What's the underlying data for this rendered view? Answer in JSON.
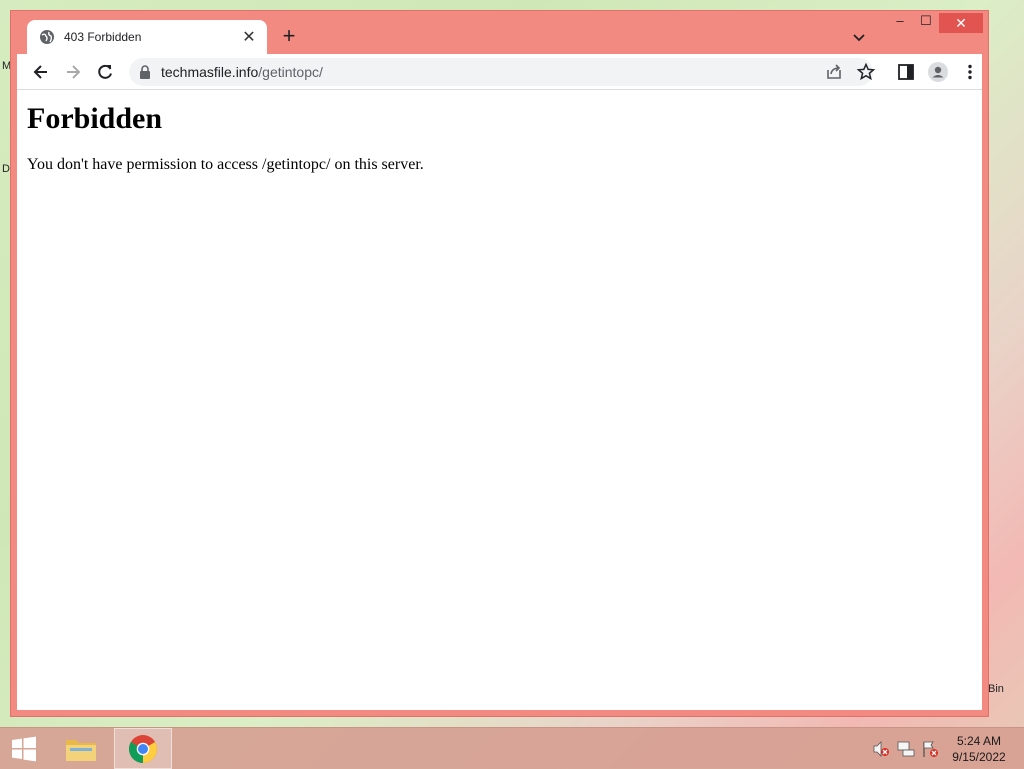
{
  "browser": {
    "tab_title": "403 Forbidden",
    "url_domain": "techmasfile.info",
    "url_path": "/getintopc/",
    "window_controls": {
      "minimize": "–",
      "maximize": "☐",
      "close": "✕"
    },
    "new_tab": "+",
    "tab_close": "✕"
  },
  "page": {
    "heading": "Forbidden",
    "message": "You don't have permission to access /getintopc/ on this server."
  },
  "desktop": {
    "edge_letter_1": "M",
    "edge_letter_2": "D",
    "recycle_bin_label": "Bin"
  },
  "taskbar": {
    "time": "5:24 AM",
    "date": "9/15/2022"
  },
  "colors": {
    "window_frame": "#f28a82",
    "close_button": "#e25450",
    "taskbar": "#d6a092"
  }
}
